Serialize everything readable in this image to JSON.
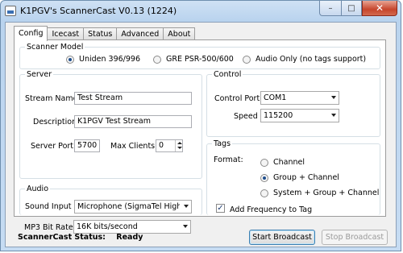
{
  "window": {
    "title": "K1PGV's ScannerCast V0.13 (1224)"
  },
  "tabs": [
    {
      "label": "Config",
      "active": true
    },
    {
      "label": "Icecast",
      "active": false
    },
    {
      "label": "Status",
      "active": false
    },
    {
      "label": "Advanced",
      "active": false
    },
    {
      "label": "About",
      "active": false
    }
  ],
  "scanner_model": {
    "legend": "Scanner Model",
    "options": [
      {
        "label": "Uniden 396/996",
        "selected": true
      },
      {
        "label": "GRE PSR-500/600",
        "selected": false
      },
      {
        "label": "Audio Only (no tags support)",
        "selected": false
      }
    ]
  },
  "server": {
    "legend": "Server",
    "stream_name_label": "Stream Name",
    "stream_name_value": "Test Stream",
    "description_label": "Description",
    "description_value": "K1PGV Test Stream",
    "port_label": "Server Port",
    "port_value": "5700",
    "max_clients_label": "Max Clients:",
    "max_clients_value": "0"
  },
  "audio": {
    "legend": "Audio",
    "sound_input_label": "Sound Input",
    "sound_input_value": "Microphone (SigmaTel High Defi",
    "bitrate_label": "MP3 Bit Rate",
    "bitrate_value": "16K bits/second"
  },
  "control": {
    "legend": "Control",
    "port_label": "Control Port",
    "port_value": "COM1",
    "speed_label": "Speed",
    "speed_value": "115200"
  },
  "tags": {
    "legend": "Tags",
    "format_label": "Format:",
    "options": [
      {
        "label": "Channel",
        "selected": false
      },
      {
        "label": "Group + Channel",
        "selected": true
      },
      {
        "label": "System + Group + Channel",
        "selected": false
      }
    ],
    "add_frequency_label": "Add Frequency to Tag",
    "add_frequency_checked": true
  },
  "status_bar": {
    "label": "ScannerCast Status:",
    "value": "Ready"
  },
  "buttons": {
    "start": "Start Broadcast",
    "stop": "Stop Broadcast"
  }
}
